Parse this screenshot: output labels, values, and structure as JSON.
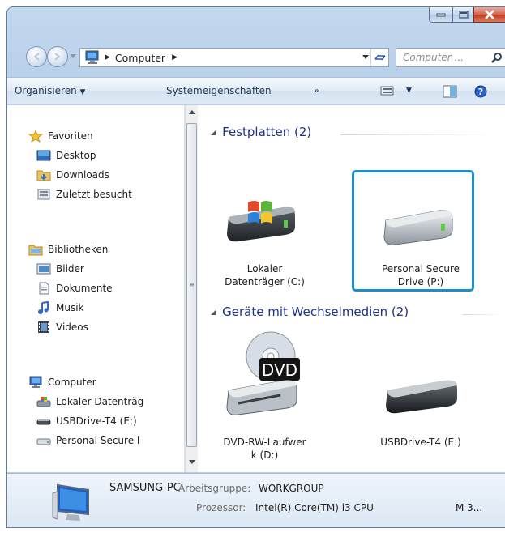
{
  "address": {
    "crumb": "Computer",
    "search_placeholder": "Computer ..."
  },
  "toolbar": {
    "organize": "Organisieren",
    "system_properties": "Systemeigenschaften",
    "more": "»"
  },
  "nav": {
    "favorites": "Favoriten",
    "desktop": "Desktop",
    "downloads": "Downloads",
    "recent": "Zuletzt besucht",
    "libraries": "Bibliotheken",
    "pictures": "Bilder",
    "documents": "Dokumente",
    "music": "Musik",
    "videos": "Videos",
    "computer": "Computer",
    "local_disk": "Lokaler Datenträg",
    "usb_drive": "USBDrive-T4 (E:)",
    "secure_drive": "Personal Secure I"
  },
  "groups": {
    "hard_drives": "Festplatten (2)",
    "removable": "Geräte mit Wechselmedien (2)"
  },
  "drives": [
    {
      "line1": "Lokaler",
      "line2": "Datenträger (C:)"
    },
    {
      "line1": "Personal Secure",
      "line2": "Drive (P:)"
    },
    {
      "line1": "DVD-RW-Laufwer",
      "line2": "k (D:)",
      "badge": "DVD"
    },
    {
      "line1": "USBDrive-T4 (E:)",
      "line2": ""
    }
  ],
  "details": {
    "name": "SAMSUNG-PC",
    "workgroup_label": "Arbeitsgruppe:",
    "workgroup_value": "WORKGROUP",
    "cpu_label": "Prozessor:",
    "cpu_value": "Intel(R) Core(TM) i3 CPU",
    "cpu_extra": "M 3..."
  },
  "colors": {
    "selection": "#1b8fcb",
    "group_header": "#1e3287"
  }
}
